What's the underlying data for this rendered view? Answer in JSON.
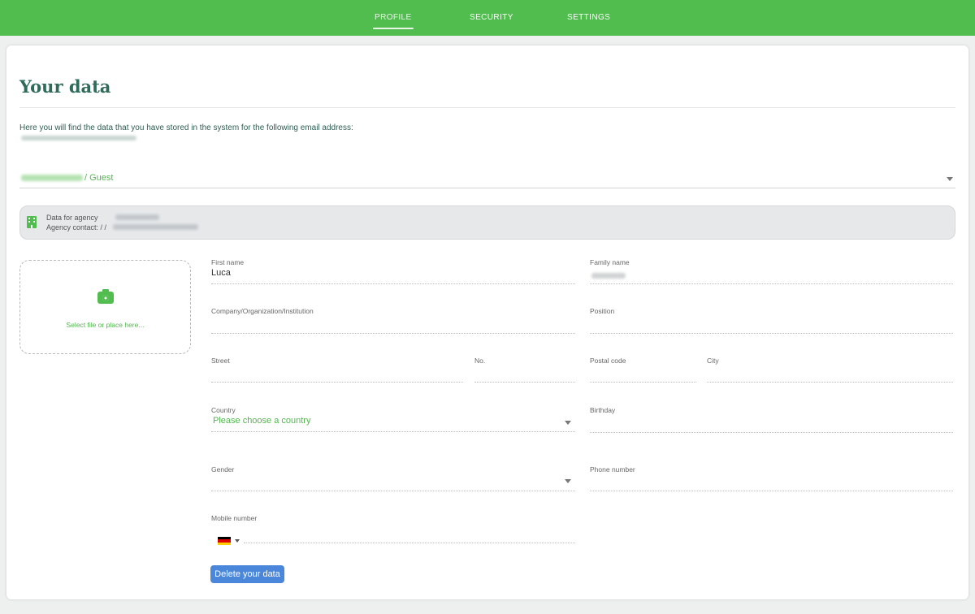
{
  "nav": {
    "tabs": [
      {
        "label": "PROFILE",
        "active": true
      },
      {
        "label": "SECURITY",
        "active": false
      },
      {
        "label": "SETTINGS",
        "active": false
      }
    ]
  },
  "page": {
    "title": "Your data",
    "intro": "Here you will find the data that you have stored in the system for the following email address:"
  },
  "account_select": {
    "value_suffix": "/ Guest"
  },
  "agency": {
    "data_label": "Data for agency",
    "contact_label": "Agency contact: / /",
    "icon": "building-icon"
  },
  "upload": {
    "icon": "camera-icon",
    "text": "Select file or place here..."
  },
  "form": {
    "first_name": {
      "label": "First name",
      "value": "Luca"
    },
    "family_name": {
      "label": "Family name"
    },
    "company": {
      "label": "Company/Organization/Institution",
      "value": ""
    },
    "position": {
      "label": "Position",
      "value": ""
    },
    "street": {
      "label": "Street",
      "value": ""
    },
    "number": {
      "label": "No.",
      "value": ""
    },
    "postal_code": {
      "label": "Postal code",
      "value": ""
    },
    "city": {
      "label": "City",
      "value": ""
    },
    "country": {
      "label": "Country",
      "placeholder": "Please choose a country"
    },
    "birthday": {
      "label": "Birthday",
      "value": ""
    },
    "gender": {
      "label": "Gender",
      "value": ""
    },
    "phone": {
      "label": "Phone number",
      "value": ""
    },
    "mobile": {
      "label": "Mobile number",
      "value": "",
      "flag_colors": [
        "#000000",
        "#dd0000",
        "#ffce00"
      ]
    }
  },
  "actions": {
    "delete_label": "Delete your data"
  },
  "colors": {
    "brand_green": "#52bd4f",
    "heading": "#2f6b5a",
    "button_blue": "#4a86d9"
  }
}
